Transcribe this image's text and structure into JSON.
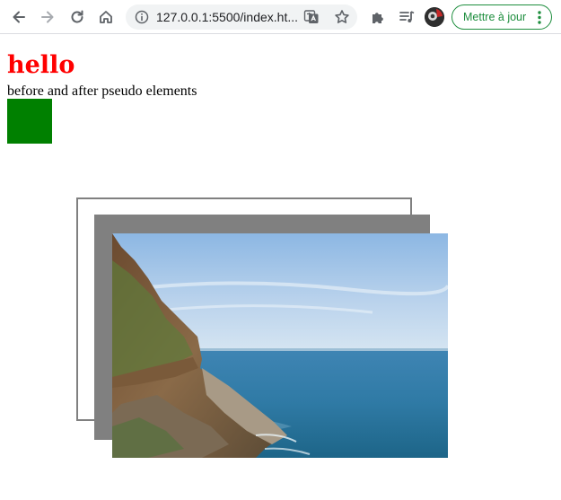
{
  "browser": {
    "url": "127.0.0.1:5500/index.ht...",
    "update_button_label": "Mettre à jour",
    "accent_color": "#1e8e3e"
  },
  "page": {
    "heading": "hello",
    "heading_color": "#ff0000",
    "subtitle": "before and after pseudo elements",
    "box_color": "#008000",
    "frame_color": "#808080",
    "image_alt": "coastal cliff and ocean"
  },
  "icons": [
    "back-arrow-icon",
    "forward-arrow-icon",
    "reload-icon",
    "home-icon",
    "info-icon",
    "translate-icon",
    "star-icon",
    "extensions-icon",
    "media-icon",
    "profile-avatar",
    "more-vert-icon"
  ]
}
